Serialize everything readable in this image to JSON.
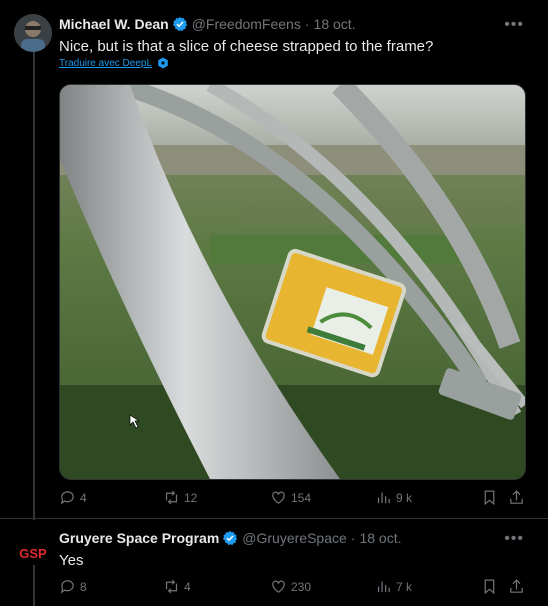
{
  "tweets": [
    {
      "author": "Michael W. Dean",
      "handle": "@FreedomFeens",
      "separator": "·",
      "date": "18 oct.",
      "text": "Nice, but is that a slice of cheese strapped to the frame?",
      "translate_label": "Traduire avec DeepL",
      "actions": {
        "replies": "4",
        "retweets": "12",
        "likes": "154",
        "views": "9 k"
      }
    },
    {
      "author": "Gruyere Space Program",
      "avatar_text": "GSP",
      "handle": "@GruyereSpace",
      "separator": "·",
      "date": "18 oct.",
      "text": "Yes",
      "actions": {
        "replies": "8",
        "retweets": "4",
        "likes": "230",
        "views": "7 k"
      }
    }
  ],
  "icons": {
    "verified": "verified-badge-icon",
    "more": "more-options-icon",
    "reply": "reply-icon",
    "retweet": "retweet-icon",
    "like": "heart-icon",
    "views": "views-chart-icon",
    "bookmark": "bookmark-icon",
    "share": "share-icon"
  },
  "colors": {
    "accent": "#1d9bf0",
    "muted": "#71767b",
    "background": "#000000"
  }
}
